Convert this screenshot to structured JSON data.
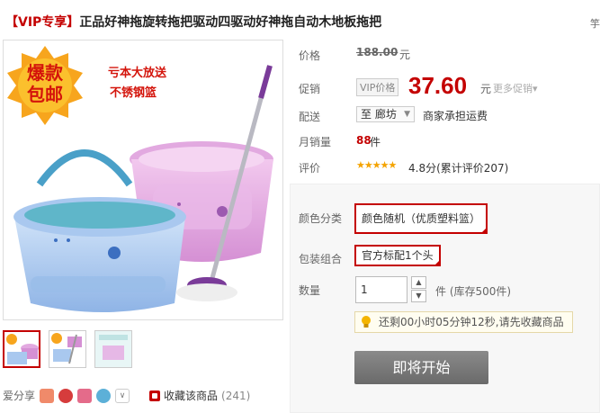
{
  "product": {
    "title_prefix": "【VIP专享】",
    "title": "正品好神拖旋转拖把驱动四驱动好神拖自动木地板拖把",
    "title_overflow_char": "竽"
  },
  "image": {
    "badge_line1": "爆款",
    "badge_line2": "包邮",
    "promo_line1": "亏本大放送",
    "promo_line2": "不锈钢篮"
  },
  "info": {
    "price_label": "价格",
    "original_price": "188.00",
    "currency_unit": "元",
    "promo_label": "促销",
    "vip_tag": "VIP价格",
    "promo_price": "37.60",
    "promo_unit": "元",
    "more_promo": "更多促销▾",
    "ship_label": "配送",
    "ship_to": "至 廊坊",
    "ship_note": "商家承担运费",
    "sales_label": "月销量",
    "sales_count": "88",
    "sales_unit": "件",
    "rating_label": "评价",
    "stars": "★★★★★",
    "rating_text": "4.8分(累计评价207)"
  },
  "purchase": {
    "color_label": "颜色分类",
    "color_option": "颜色随机（优质塑料篮）",
    "package_label": "包装组合",
    "package_option": "官方标配1个头",
    "qty_label": "数量",
    "qty_value": "1",
    "stock_text": "件 (库存500件)",
    "tip_text": "还剩00小时05分钟12秒,请先收藏商品",
    "buy_button": "即将开始"
  },
  "share": {
    "label": "爱分享",
    "collect_label": "收藏该商品",
    "collect_count": "(241)"
  },
  "colors": {
    "accent": "#c40000",
    "star": "#f4a300",
    "button_gray": "#7a7a7a"
  }
}
